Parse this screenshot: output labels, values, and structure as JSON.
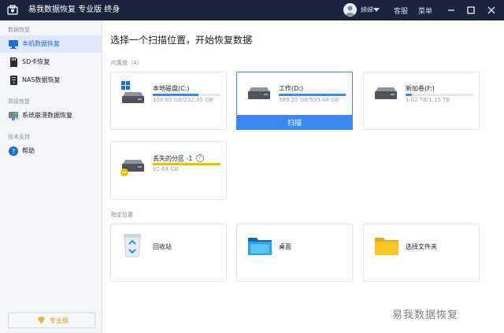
{
  "titlebar": {
    "app_title": "易我数据恢复 专业版 终身",
    "user_name": "娣娣",
    "support_label": "客服",
    "menu_label": "菜单"
  },
  "sidebar": {
    "groups": [
      {
        "label": "数据恢复"
      },
      {
        "label": "高级恢复"
      },
      {
        "label": "技术支持"
      }
    ],
    "items": [
      {
        "label": "本机数据恢复",
        "active": true
      },
      {
        "label": "SD卡恢复"
      },
      {
        "label": "NAS数据恢复"
      },
      {
        "label": "系统崩溃数据恢复"
      },
      {
        "label": "帮助"
      }
    ],
    "pro_label": "专业版"
  },
  "main": {
    "title": "选择一个扫描位置，开始恢复数据",
    "refresh_glyph": "C",
    "builtin_label": "内置盘（4）",
    "drives": [
      {
        "name": "本地磁盘(C:)",
        "size": "158.85 GB/232.35 GB",
        "used_fraction": 0.68,
        "bar_color": "#3d87f0"
      },
      {
        "name": "工作(D:)",
        "size": "589.25 GB/593.48 GB",
        "used_fraction": 0.99,
        "bar_color": "#3d87f0",
        "scan_label": "扫描"
      },
      {
        "name": "新加卷(F:)",
        "size": "1.02 TB/1.15 TB",
        "used_fraction": 0.09,
        "bar_color": "#3d87f0"
      },
      {
        "name": "丢失的分区 -1",
        "size": "92.64 GB",
        "used_fraction": 1.0,
        "bar_color": "#f0c000",
        "help_glyph": "?"
      }
    ],
    "specified_label": "指定位置",
    "locations": [
      {
        "label": "回收站"
      },
      {
        "label": "桌面"
      },
      {
        "label": "选择文件夹"
      }
    ]
  },
  "watermark": "易我数据恢复"
}
